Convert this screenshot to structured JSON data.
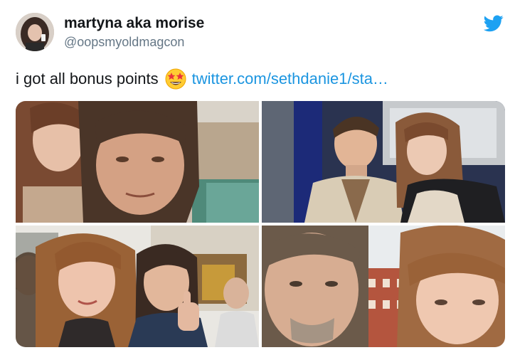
{
  "user": {
    "display_name": "martyna aka morise",
    "handle": "@oopsmyoldmagcon"
  },
  "tweet": {
    "text": "i got all bonus points",
    "emoji": "star-struck-emoji",
    "link": "twitter.com/sethdanie1/sta…"
  },
  "icons": {
    "brand": "twitter-bird-icon",
    "brand_color": "#1da1f2"
  },
  "colors": {
    "link": "#1b95e0",
    "name": "#14171a",
    "handle": "#657786"
  },
  "photos": [
    {
      "name": "photo-selfie-1"
    },
    {
      "name": "photo-selfie-2"
    },
    {
      "name": "photo-selfie-3"
    },
    {
      "name": "photo-selfie-4"
    }
  ]
}
